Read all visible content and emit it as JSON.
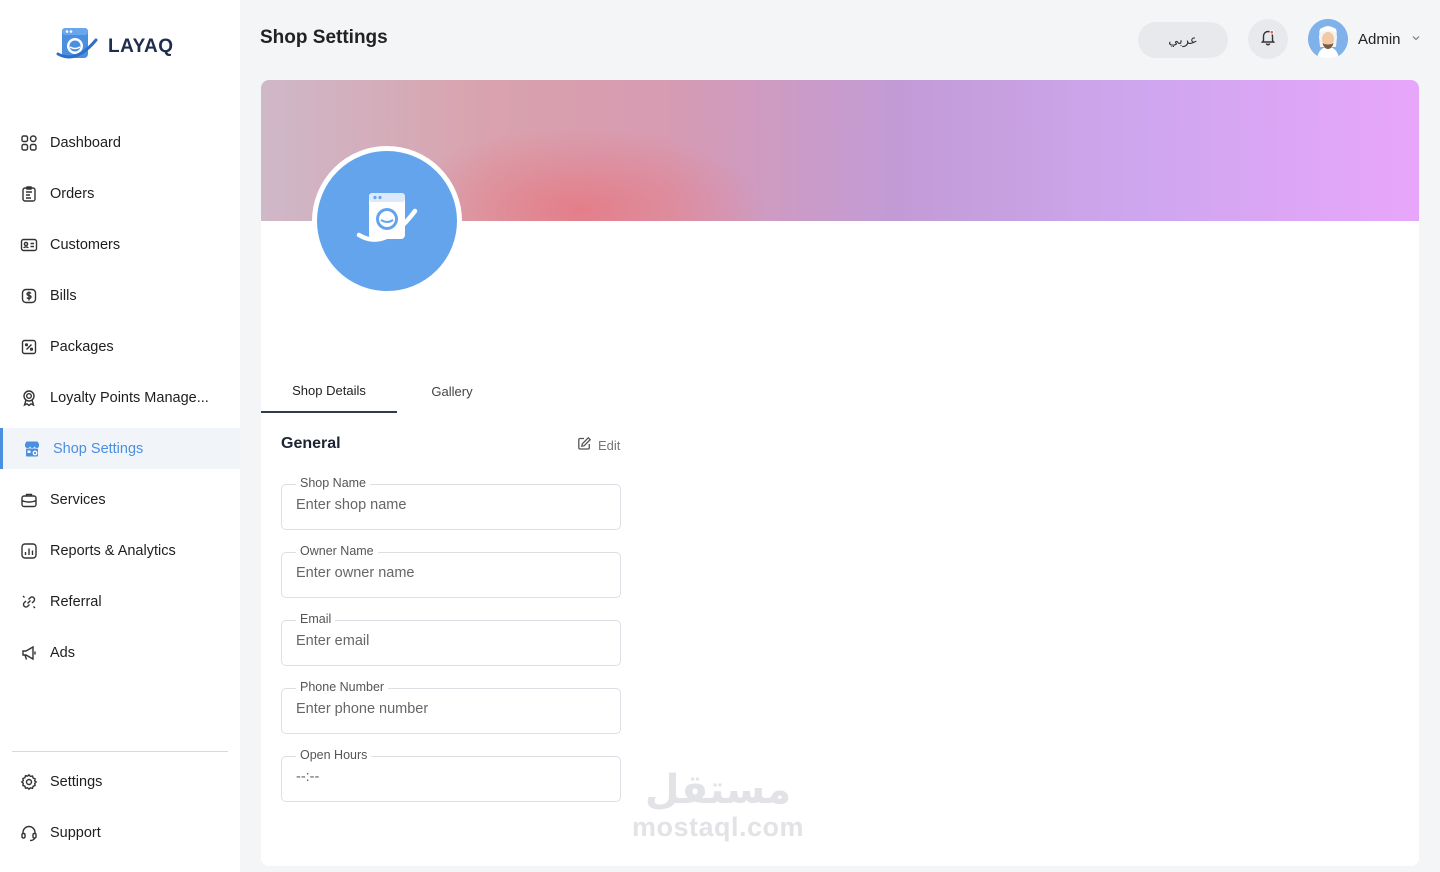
{
  "app": {
    "name": "LAYAQ"
  },
  "sidebar": {
    "items": [
      {
        "label": "Dashboard",
        "icon": "grid-icon"
      },
      {
        "label": "Orders",
        "icon": "clipboard-icon"
      },
      {
        "label": "Customers",
        "icon": "id-card-icon"
      },
      {
        "label": "Bills",
        "icon": "dollar-icon"
      },
      {
        "label": "Packages",
        "icon": "percent-tag-icon"
      },
      {
        "label": "Loyalty Points Manage...",
        "icon": "award-icon"
      },
      {
        "label": "Shop Settings",
        "icon": "store-icon",
        "active": true
      },
      {
        "label": "Services",
        "icon": "briefcase-icon"
      },
      {
        "label": "Reports & Analytics",
        "icon": "chart-icon"
      },
      {
        "label": "Referral",
        "icon": "link-icon"
      },
      {
        "label": "Ads",
        "icon": "megaphone-icon"
      }
    ],
    "bottom": [
      {
        "label": "Settings",
        "icon": "gear-icon"
      },
      {
        "label": "Support",
        "icon": "headset-icon"
      }
    ]
  },
  "header": {
    "title": "Shop Settings",
    "language": "عربي",
    "user": "Admin"
  },
  "tabs": [
    {
      "label": "Shop Details",
      "active": true
    },
    {
      "label": "Gallery",
      "active": false
    }
  ],
  "general": {
    "title": "General",
    "edit": "Edit",
    "fields": [
      {
        "label": "Shop Name",
        "placeholder": "Enter shop name"
      },
      {
        "label": "Owner Name",
        "placeholder": "Enter owner name"
      },
      {
        "label": "Email",
        "placeholder": "Enter email"
      },
      {
        "label": "Phone Number",
        "placeholder": "Enter phone number"
      },
      {
        "label": "Open Hours",
        "placeholder": "--:--"
      }
    ]
  },
  "watermark": {
    "arabic": "مستقل",
    "latin": "mostaql.com"
  },
  "colors": {
    "accent": "#4a8fe0",
    "avatar_bg": "#64a4ec",
    "brand_dark": "#1f2d4d"
  }
}
